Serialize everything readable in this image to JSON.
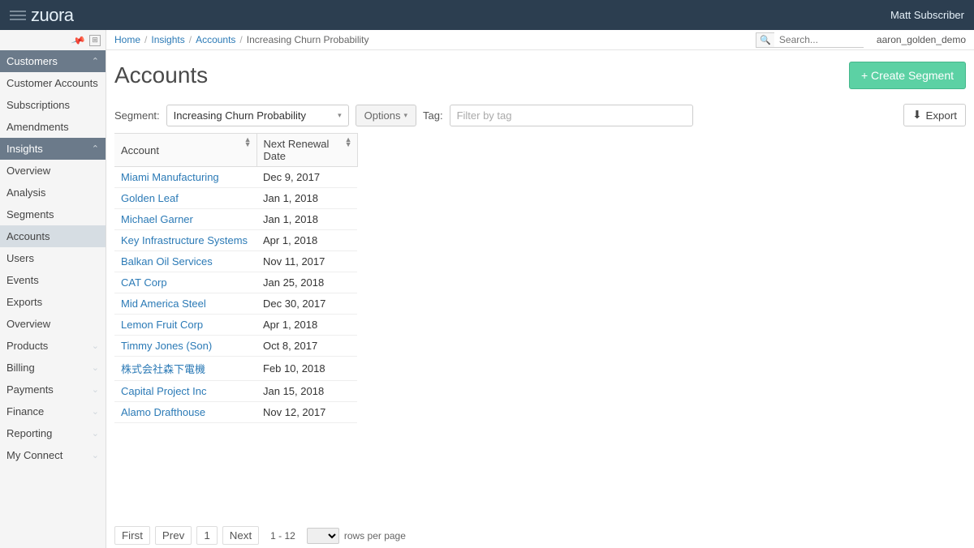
{
  "topbar": {
    "logo": "zuora",
    "user": "Matt Subscriber"
  },
  "sidebar": {
    "customers_header": "Customers",
    "customers_items": [
      "Customer Accounts",
      "Subscriptions",
      "Amendments"
    ],
    "insights_header": "Insights",
    "insights_items": [
      "Overview",
      "Analysis",
      "Segments",
      "Accounts",
      "Users",
      "Events",
      "Exports",
      "Overview"
    ],
    "sections": [
      "Products",
      "Billing",
      "Payments",
      "Finance",
      "Reporting",
      "My Connect"
    ]
  },
  "breadcrumb": {
    "home": "Home",
    "insights": "Insights",
    "accounts": "Accounts",
    "current": "Increasing Churn Probability",
    "search_placeholder": "Search...",
    "env": "aaron_golden_demo"
  },
  "page": {
    "title": "Accounts",
    "create_btn": "+ Create Segment",
    "segment_label": "Segment:",
    "segment_value": "Increasing Churn Probability",
    "options_btn": "Options",
    "tag_label": "Tag:",
    "tag_placeholder": "Filter by tag",
    "export_btn": "Export"
  },
  "table": {
    "col_account": "Account",
    "col_date": "Next Renewal Date",
    "rows": [
      {
        "name": "Miami Manufacturing",
        "date": "Dec 9, 2017"
      },
      {
        "name": "Golden Leaf",
        "date": "Jan 1, 2018"
      },
      {
        "name": "Michael Garner",
        "date": "Jan 1, 2018"
      },
      {
        "name": "Key Infrastructure Systems",
        "date": "Apr 1, 2018"
      },
      {
        "name": "Balkan Oil Services",
        "date": "Nov 11, 2017"
      },
      {
        "name": "CAT Corp",
        "date": "Jan 25, 2018"
      },
      {
        "name": "Mid America Steel",
        "date": "Dec 30, 2017"
      },
      {
        "name": "Lemon Fruit Corp",
        "date": "Apr 1, 2018"
      },
      {
        "name": "Timmy Jones (Son)",
        "date": "Oct 8, 2017"
      },
      {
        "name": "株式会社森下電機",
        "date": "Feb 10, 2018"
      },
      {
        "name": "Capital Project Inc",
        "date": "Jan 15, 2018"
      },
      {
        "name": "Alamo Drafthouse",
        "date": "Nov 12, 2017"
      }
    ]
  },
  "pager": {
    "first": "First",
    "prev": "Prev",
    "page": "1",
    "next": "Next",
    "range": "1 - 12",
    "rows_label": "rows per page"
  }
}
